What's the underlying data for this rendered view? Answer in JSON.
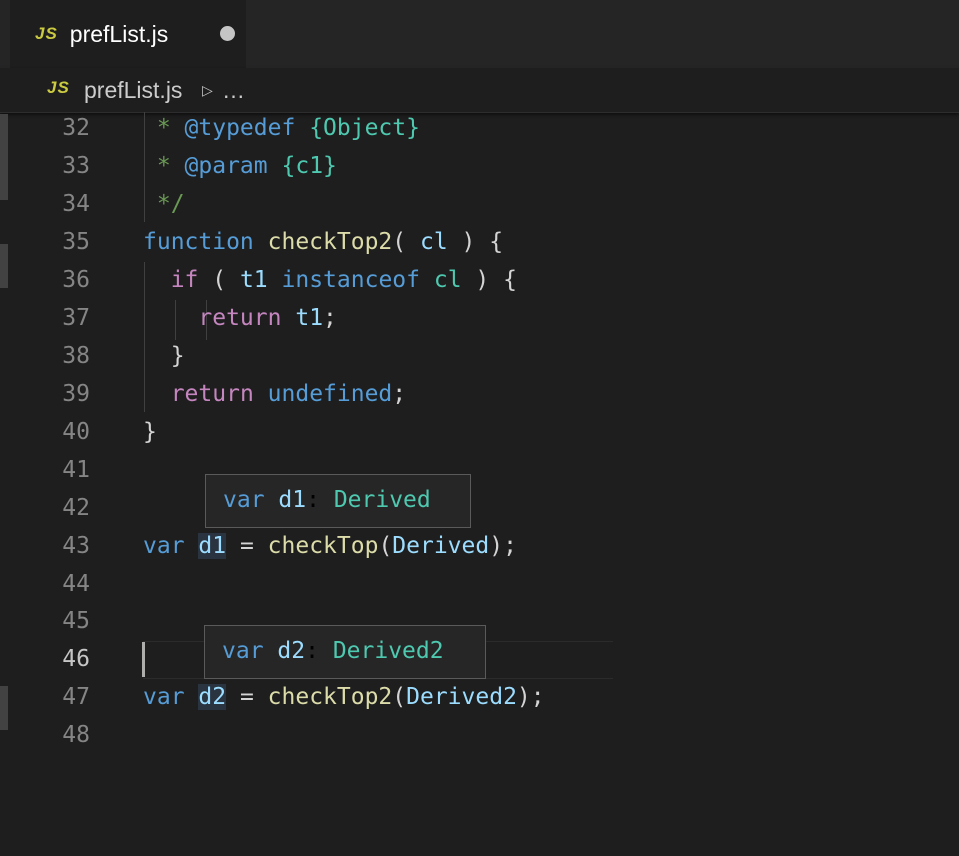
{
  "tab": {
    "icon_text": "JS",
    "filename": "prefList.js"
  },
  "breadcrumb": {
    "icon_text": "JS",
    "filename": "prefList.js",
    "more": "…"
  },
  "line_numbers": [
    "32",
    "33",
    "34",
    "35",
    "36",
    "37",
    "38",
    "39",
    "40",
    "41",
    "42",
    "43",
    "44",
    "45",
    "46",
    "47",
    "48"
  ],
  "code": {
    "l32_star": " * ",
    "l32_tag": "@typedef",
    "l32_type": "{Object}",
    "l33_star": " * ",
    "l33_tag": "@param",
    "l33_type": "{c1}",
    "l34": " */",
    "l35_kw": "function",
    "l35_fn": "checkTop2",
    "l35_open": "( ",
    "l35_param": "cl",
    "l35_close": " ) {",
    "l36_if": "if",
    "l36_open": " ( ",
    "l36_t1": "t1",
    "l36_inst": "instanceof",
    "l36_cl": "cl",
    "l36_close": " ) {",
    "l37_ret": "return",
    "l37_t1": "t1",
    "l37_semi": ";",
    "l38": "}",
    "l39_ret": "return",
    "l39_undef": "undefined",
    "l39_semi": ";",
    "l40": "}",
    "l43_var": "var",
    "l43_name": "d1",
    "l43_eq": " = ",
    "l43_fn": "checkTop",
    "l43_open": "(",
    "l43_arg": "Derived",
    "l43_close": ");",
    "l47_var": "var",
    "l47_name": "d2",
    "l47_eq": " = ",
    "l47_fn": "checkTop2",
    "l47_open": "(",
    "l47_arg": "Derived2",
    "l47_close": ");"
  },
  "hints": [
    {
      "kw": "var",
      "name": "d1",
      "colon": ": ",
      "type": "Derived"
    },
    {
      "kw": "var",
      "name": "d2",
      "colon": ": ",
      "type": "Derived2"
    }
  ],
  "colors": {
    "background": "#1e1e1e",
    "keyword": "#569cd6",
    "function": "#dcdcaa",
    "variable": "#9cdcfe",
    "type": "#4ec9b0",
    "comment": "#6a9955",
    "control": "#c586c0"
  },
  "icons": {
    "tab_dirty": "dot-icon",
    "breadcrumb_separator": "chevron-right-icon"
  }
}
